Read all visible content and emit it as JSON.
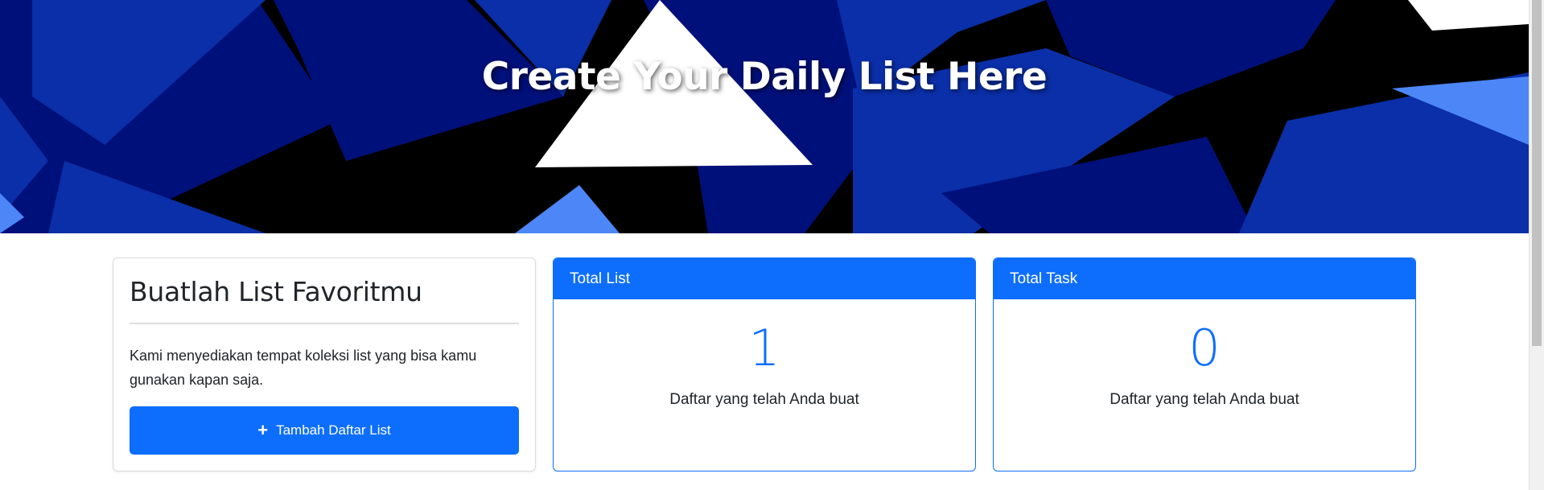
{
  "hero": {
    "title": "Create Your Daily List Here"
  },
  "intro_card": {
    "heading": "Buatlah List Favoritmu",
    "description": "Kami menyediakan tempat koleksi list yang bisa kamu gunakan kapan saja.",
    "add_button_label": "Tambah Daftar List",
    "add_button_icon": "plus-icon"
  },
  "stats": {
    "total_list": {
      "title": "Total List",
      "value": "1",
      "caption": "Daftar yang telah Anda buat"
    },
    "total_task": {
      "title": "Total Task",
      "value": "0",
      "caption": "Daftar yang telah Anda buat"
    }
  },
  "colors": {
    "primary": "#0d6efd",
    "hero_dark_blue": "#00107a",
    "hero_royal_blue": "#0a2fa8",
    "hero_light_blue": "#4d86f7",
    "hero_black": "#000000",
    "hero_white": "#ffffff"
  }
}
